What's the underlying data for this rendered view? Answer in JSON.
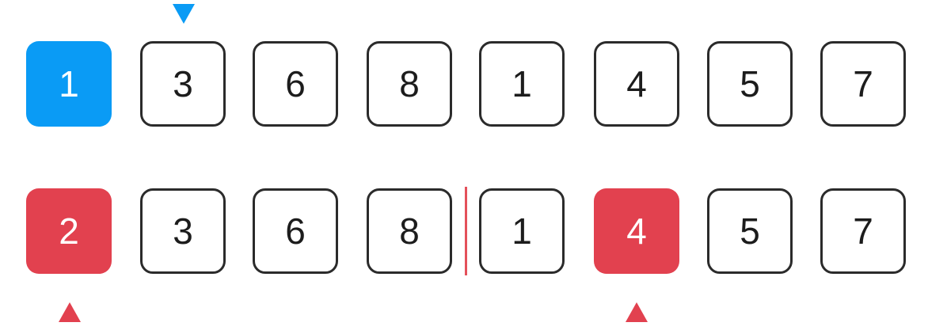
{
  "top_row": {
    "cells": [
      "1",
      "3",
      "6",
      "8",
      "1",
      "4",
      "5",
      "7"
    ],
    "highlighted_index": 0,
    "highlight_color": "#0a9bf5"
  },
  "bottom_row": {
    "cells": [
      "2",
      "3",
      "6",
      "8",
      "1",
      "4",
      "5",
      "7"
    ],
    "highlighted_indices": [
      0,
      5
    ],
    "highlight_color": "#e2414f"
  },
  "colors": {
    "cell_border": "#2b2b2b",
    "divider": "#e4505a",
    "pointer_top": "#0a9bf5",
    "pointer_bottom": "#e2414f"
  },
  "markers": {
    "top_pointer_icon": "triangle-down-icon",
    "bottom_pointer_icon": "triangle-up-icon"
  }
}
